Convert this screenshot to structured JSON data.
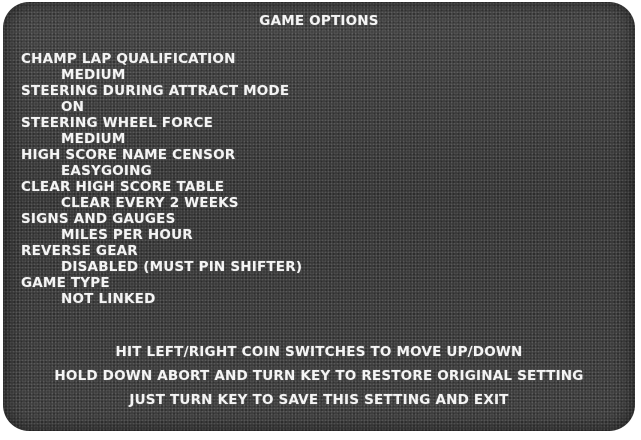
{
  "title": "GAME OPTIONS",
  "options": [
    {
      "label": "CHAMP LAP QUALIFICATION",
      "value": "MEDIUM"
    },
    {
      "label": "STEERING DURING ATTRACT MODE",
      "value": "ON"
    },
    {
      "label": "STEERING WHEEL FORCE",
      "value": "MEDIUM"
    },
    {
      "label": "HIGH SCORE NAME CENSOR",
      "value": "EASYGOING"
    },
    {
      "label": "CLEAR HIGH SCORE TABLE",
      "value": "CLEAR EVERY 2 WEEKS"
    },
    {
      "label": "SIGNS AND GAUGES",
      "value": "MILES PER HOUR"
    },
    {
      "label": "REVERSE GEAR",
      "value": "DISABLED (MUST PIN SHIFTER)"
    },
    {
      "label": "GAME TYPE",
      "value": "NOT LINKED"
    }
  ],
  "instructions": [
    "HIT LEFT/RIGHT COIN SWITCHES TO MOVE UP/DOWN",
    "HOLD DOWN ABORT AND TURN KEY TO RESTORE ORIGINAL SETTING",
    "JUST TURN KEY TO SAVE THIS SETTING AND EXIT"
  ]
}
